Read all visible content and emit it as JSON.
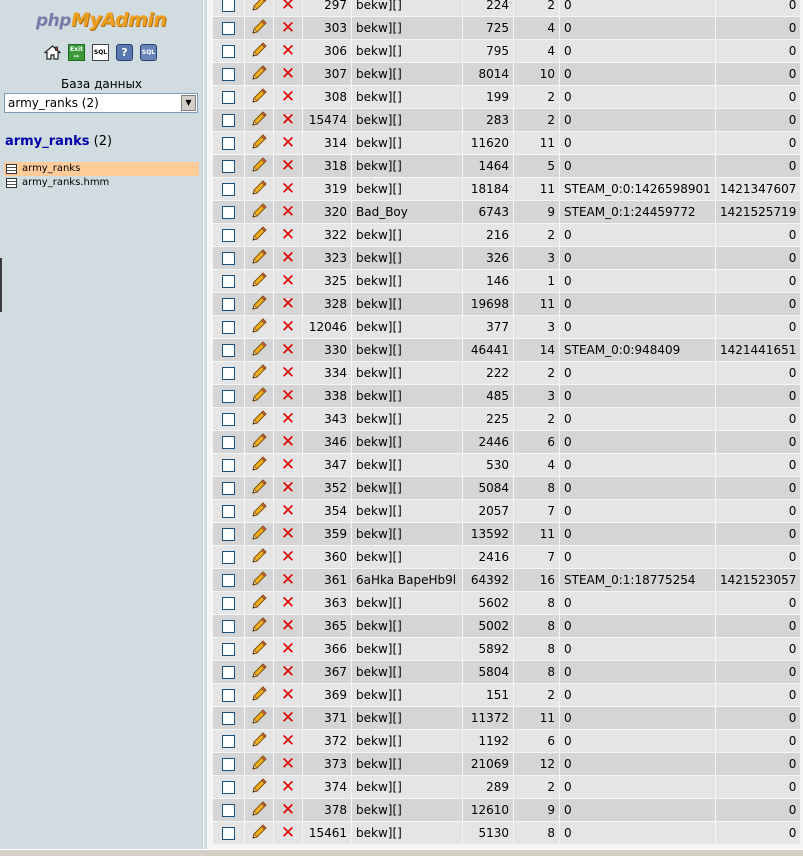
{
  "nav": {
    "logo_php": "php",
    "logo_myadmin": "MyAdmin",
    "icons": [
      "home-icon",
      "exit-icon",
      "sql-query-icon",
      "help-icon",
      "sql-docs-icon"
    ],
    "icon_text": {
      "exit": "Exit",
      "sql": "SQL",
      "help": "?",
      "docs": "SQL"
    },
    "db_label": "База данных",
    "db_select_value": "army_ranks (2)",
    "db_heading_name": "army_ranks",
    "db_heading_count": "(2)",
    "tables": [
      "army_ranks",
      "army_ranks.hmm"
    ]
  },
  "colors": {
    "accent": "#0000aa",
    "active_table": "#ffcc99",
    "delete": "#e00000",
    "nav_bg": "#d0dce0"
  },
  "rows": [
    [
      "297",
      "bekw][]",
      "224",
      "2",
      "0",
      "0"
    ],
    [
      "303",
      "bekw][]",
      "725",
      "4",
      "0",
      "0"
    ],
    [
      "306",
      "bekw][]",
      "795",
      "4",
      "0",
      "0"
    ],
    [
      "307",
      "bekw][]",
      "8014",
      "10",
      "0",
      "0"
    ],
    [
      "308",
      "bekw][]",
      "199",
      "2",
      "0",
      "0"
    ],
    [
      "15474",
      "bekw][]",
      "283",
      "2",
      "0",
      "0"
    ],
    [
      "314",
      "bekw][]",
      "11620",
      "11",
      "0",
      "0"
    ],
    [
      "318",
      "bekw][]",
      "1464",
      "5",
      "0",
      "0"
    ],
    [
      "319",
      "bekw][]",
      "18184",
      "11",
      "STEAM_0:0:1426598901",
      "1421347607"
    ],
    [
      "320",
      "Bad_Boy",
      "6743",
      "9",
      "STEAM_0:1:24459772",
      "1421525719"
    ],
    [
      "322",
      "bekw][]",
      "216",
      "2",
      "0",
      "0"
    ],
    [
      "323",
      "bekw][]",
      "326",
      "3",
      "0",
      "0"
    ],
    [
      "325",
      "bekw][]",
      "146",
      "1",
      "0",
      "0"
    ],
    [
      "328",
      "bekw][]",
      "19698",
      "11",
      "0",
      "0"
    ],
    [
      "12046",
      "bekw][]",
      "377",
      "3",
      "0",
      "0"
    ],
    [
      "330",
      "bekw][]",
      "46441",
      "14",
      "STEAM_0:0:948409",
      "1421441651"
    ],
    [
      "334",
      "bekw][]",
      "222",
      "2",
      "0",
      "0"
    ],
    [
      "338",
      "bekw][]",
      "485",
      "3",
      "0",
      "0"
    ],
    [
      "343",
      "bekw][]",
      "225",
      "2",
      "0",
      "0"
    ],
    [
      "346",
      "bekw][]",
      "2446",
      "6",
      "0",
      "0"
    ],
    [
      "347",
      "bekw][]",
      "530",
      "4",
      "0",
      "0"
    ],
    [
      "352",
      "bekw][]",
      "5084",
      "8",
      "0",
      "0"
    ],
    [
      "354",
      "bekw][]",
      "2057",
      "7",
      "0",
      "0"
    ],
    [
      "359",
      "bekw][]",
      "13592",
      "11",
      "0",
      "0"
    ],
    [
      "360",
      "bekw][]",
      "2416",
      "7",
      "0",
      "0"
    ],
    [
      "361",
      "6aHka BapeHb9l",
      "64392",
      "16",
      "STEAM_0:1:18775254",
      "1421523057"
    ],
    [
      "363",
      "bekw][]",
      "5602",
      "8",
      "0",
      "0"
    ],
    [
      "365",
      "bekw][]",
      "5002",
      "8",
      "0",
      "0"
    ],
    [
      "366",
      "bekw][]",
      "5892",
      "8",
      "0",
      "0"
    ],
    [
      "367",
      "bekw][]",
      "5804",
      "8",
      "0",
      "0"
    ],
    [
      "369",
      "bekw][]",
      "151",
      "2",
      "0",
      "0"
    ],
    [
      "371",
      "bekw][]",
      "11372",
      "11",
      "0",
      "0"
    ],
    [
      "372",
      "bekw][]",
      "1192",
      "6",
      "0",
      "0"
    ],
    [
      "373",
      "bekw][]",
      "21069",
      "12",
      "0",
      "0"
    ],
    [
      "374",
      "bekw][]",
      "289",
      "2",
      "0",
      "0"
    ],
    [
      "378",
      "bekw][]",
      "12610",
      "9",
      "0",
      "0"
    ],
    [
      "15461",
      "bekw][]",
      "5130",
      "8",
      "0",
      "0"
    ]
  ]
}
